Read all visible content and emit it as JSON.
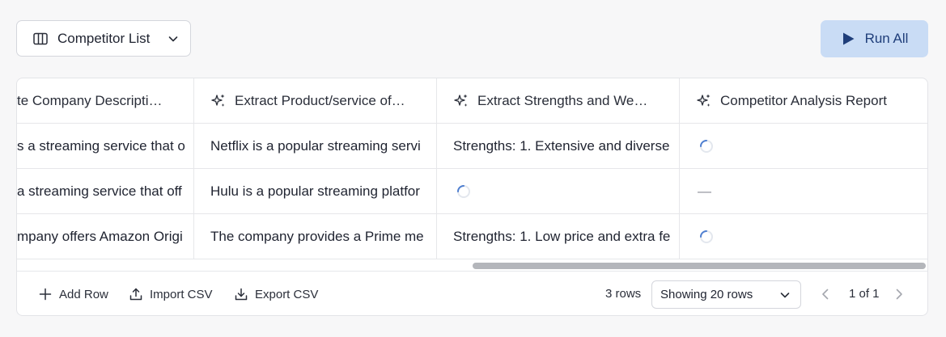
{
  "toolbar": {
    "view_label": "Competitor List",
    "run_all_label": "Run All"
  },
  "table": {
    "columns": [
      "te Company Descripti…",
      "Extract Product/service of…",
      "Extract Strengths and We…",
      "Competitor Analysis Report"
    ],
    "rows": [
      {
        "c0": "s a streaming service that o",
        "c1": "Netflix is a popular streaming servi",
        "c2": "Strengths: 1. Extensive and diverse",
        "c3": ""
      },
      {
        "c0": "a streaming service that off",
        "c1": "Hulu is a popular streaming platfor",
        "c2": "",
        "c3": "—"
      },
      {
        "c0": "mpany offers Amazon Origi",
        "c1": "The company provides a Prime me",
        "c2": "Strengths: 1. Low price and extra fe",
        "c3": ""
      }
    ]
  },
  "footer": {
    "add_row_label": "Add Row",
    "import_label": "Import CSV",
    "export_label": "Export CSV",
    "rows_count": "3 rows",
    "page_size_label": "Showing 20 rows",
    "page_indicator": "1 of 1"
  },
  "colors": {
    "accent_button_bg": "#c9dcf5",
    "accent_text": "#1f3e7a",
    "spinner": "#4f7fd0"
  }
}
